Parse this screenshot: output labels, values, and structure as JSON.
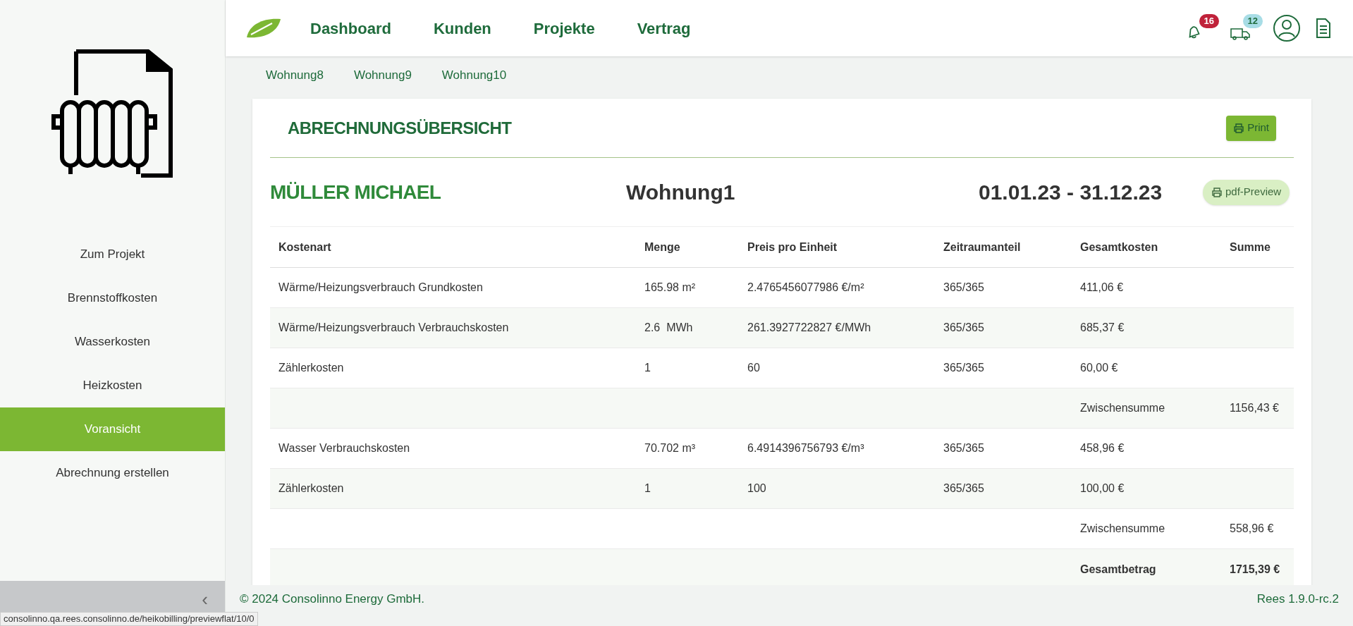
{
  "sidebar": {
    "items": [
      {
        "label": "Zum Projekt",
        "selected": false
      },
      {
        "label": "Brennstoffkosten",
        "selected": false
      },
      {
        "label": "Wasserkosten",
        "selected": false
      },
      {
        "label": "Heizkosten",
        "selected": false
      },
      {
        "label": "Voransicht",
        "selected": true
      },
      {
        "label": "Abrechnung erstellen",
        "selected": false
      }
    ],
    "collapse": "‹"
  },
  "nav": {
    "links": [
      "Dashboard",
      "Kunden",
      "Projekte",
      "Vertrag"
    ],
    "badges": [
      {
        "kind": "bell",
        "count": "16",
        "color": "#c0223a"
      },
      {
        "kind": "truck",
        "count": "12",
        "color": "#a8dde6"
      }
    ]
  },
  "tabs": [
    {
      "label": "Wohnung8"
    },
    {
      "label": "Wohnung9"
    },
    {
      "label": "Wohnung10"
    }
  ],
  "card": {
    "title": "ABRECHNUNGSÜBERSICHT",
    "print": "Print",
    "name": "MÜLLER MICHAEL",
    "unit": "Wohnung1",
    "period": "01.01.23 - 31.12.23",
    "preview": "pdf-Preview"
  },
  "table": {
    "columns": [
      "Kostenart",
      "Menge",
      "Preis pro Einheit",
      "Zeitraumanteil",
      "Gesamtkosten",
      "Summe"
    ],
    "rows": [
      {
        "kind": "item",
        "cells": [
          "Wärme/Heizungsverbrauch Grundkosten",
          "165.98 m²",
          "2.4765456077986 €/m²",
          "365/365",
          "411,06 €"
        ]
      },
      {
        "kind": "item",
        "cells": [
          "Wärme/Heizungsverbrauch Verbrauchskosten",
          "2.6  MWh",
          "261.3927722827 €/MWh",
          "365/365",
          "685,37 €"
        ]
      },
      {
        "kind": "item",
        "cells": [
          "Zählerkosten",
          "1",
          "60",
          "365/365",
          "60,00 €"
        ]
      },
      {
        "kind": "subtotal",
        "label": "Zwischensumme",
        "value": "1156,43 €"
      },
      {
        "kind": "item",
        "cells": [
          "Wasser Verbrauchskosten",
          "70.702 m³",
          "6.4914396756793 €/m³",
          "365/365",
          "458,96 €"
        ]
      },
      {
        "kind": "item",
        "cells": [
          "Zählerkosten",
          "1",
          "100",
          "365/365",
          "100,00 €"
        ]
      },
      {
        "kind": "subtotal",
        "label": "Zwischensumme",
        "value": "558,96 €"
      },
      {
        "kind": "total",
        "label": "Gesamtbetrag",
        "value": "1715,39 €"
      }
    ]
  },
  "footer": {
    "copyright": "© 2024 Consolinno Energy GmbH.",
    "version": "Rees 1.9.0-rc.2"
  },
  "status_url": "consolinno.qa.rees.consolinno.de/heikobilling/previewflat/10/0"
}
